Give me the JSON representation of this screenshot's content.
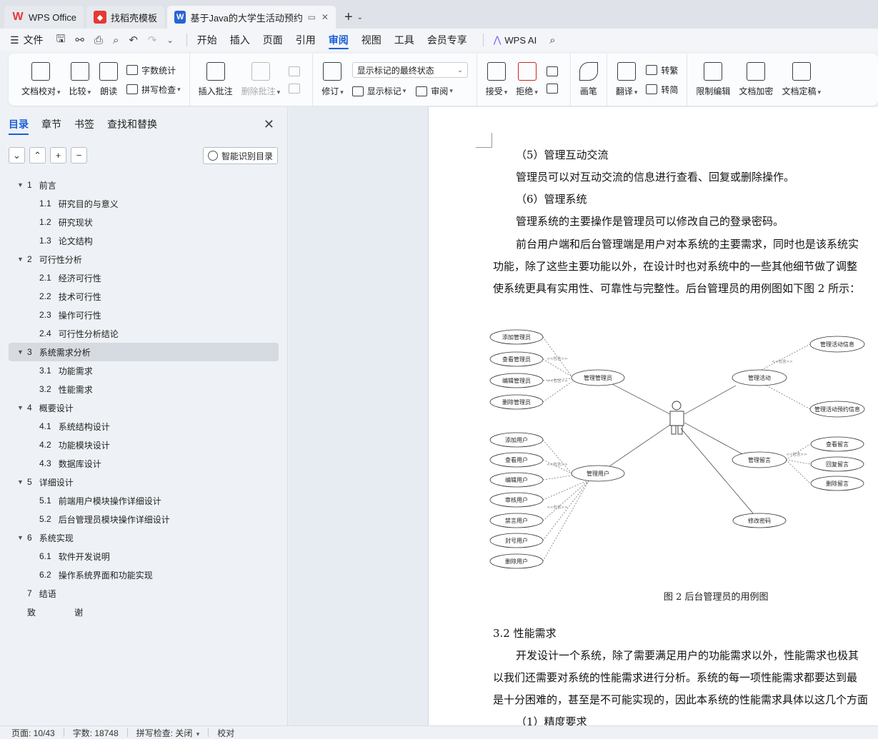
{
  "tabs": [
    {
      "label": "WPS Office",
      "icon": "wps-logo-icon"
    },
    {
      "label": "找稻壳模板",
      "icon": "daoke-logo-icon"
    },
    {
      "label": "基于Java的大学生活动预约系",
      "icon": "writer-logo-icon"
    }
  ],
  "menubar": {
    "file": "文件",
    "items": [
      "开始",
      "插入",
      "页面",
      "引用",
      "审阅",
      "视图",
      "工具",
      "会员专享"
    ],
    "active": "审阅",
    "ai": "WPS AI"
  },
  "ribbon": {
    "doc_check": "文档校对",
    "compare": "比较",
    "read": "朗读",
    "word_count": "字数统计",
    "spell_check": "拼写检查",
    "insert_comment": "插入批注",
    "delete_comment": "删除批注",
    "revise": "修订",
    "show_mode": "显示标记的最终状态",
    "show_marks": "显示标记",
    "review": "审阅",
    "accept": "接受",
    "reject": "拒绝",
    "ink": "画笔",
    "translate": "翻译",
    "to_traditional": "转繁",
    "to_simplified": "转简",
    "restrict_edit": "限制编辑",
    "encrypt": "文档加密",
    "finalize": "文档定稿"
  },
  "nav": {
    "tabs": [
      "目录",
      "章节",
      "书签",
      "查找和替换"
    ],
    "smart_toc": "智能识别目录",
    "toc": [
      {
        "num": "1",
        "title": "前言",
        "level": 1,
        "expanded": true
      },
      {
        "num": "1.1",
        "title": "研究目的与意义",
        "level": 2
      },
      {
        "num": "1.2",
        "title": "研究现状",
        "level": 2
      },
      {
        "num": "1.3",
        "title": "论文结构",
        "level": 2
      },
      {
        "num": "2",
        "title": "可行性分析",
        "level": 1,
        "expanded": true
      },
      {
        "num": "2.1",
        "title": "经济可行性",
        "level": 2
      },
      {
        "num": "2.2",
        "title": "技术可行性",
        "level": 2
      },
      {
        "num": "2.3",
        "title": "操作可行性",
        "level": 2
      },
      {
        "num": "2.4",
        "title": "可行性分析结论",
        "level": 2
      },
      {
        "num": "3",
        "title": "系统需求分析",
        "level": 1,
        "expanded": true,
        "selected": true
      },
      {
        "num": "3.1",
        "title": "功能需求",
        "level": 2
      },
      {
        "num": "3.2",
        "title": "性能需求",
        "level": 2
      },
      {
        "num": "4",
        "title": "概要设计",
        "level": 1,
        "expanded": true
      },
      {
        "num": "4.1",
        "title": "系统结构设计",
        "level": 2
      },
      {
        "num": "4.2",
        "title": "功能模块设计",
        "level": 2
      },
      {
        "num": "4.3",
        "title": "数据库设计",
        "level": 2
      },
      {
        "num": "5",
        "title": "详细设计",
        "level": 1,
        "expanded": true
      },
      {
        "num": "5.1",
        "title": "前端用户模块操作详细设计",
        "level": 2
      },
      {
        "num": "5.2",
        "title": "后台管理员模块操作详细设计",
        "level": 2
      },
      {
        "num": "6",
        "title": "系统实现",
        "level": 1,
        "expanded": true
      },
      {
        "num": "6.1",
        "title": "软件开发说明",
        "level": 2
      },
      {
        "num": "6.2",
        "title": "操作系统界面和功能实现",
        "level": 2
      },
      {
        "num": "7",
        "title": "结语",
        "level": 1,
        "expanded": false
      },
      {
        "num": "致",
        "title": "谢",
        "level": 1,
        "expanded": false,
        "wide": true
      }
    ]
  },
  "doc": {
    "lines": [
      "（5）管理互动交流",
      "管理员可以对互动交流的信息进行查看、回复或删除操作。",
      "（6）管理系统",
      "管理系统的主要操作是管理员可以修改自己的登录密码。",
      "前台用户端和后台管理端是用户对本系统的主要需求，同时也是该系统实",
      "功能，除了这些主要功能以外，在设计时也对系统中的一些其他细节做了调整",
      "使系统更具有实用性、可靠性与完整性。后台管理员的用例图如下图 2 所示：",
      "3.2    性能需求",
      "开发设计一个系统，除了需要满足用户的功能需求以外，性能需求也极其",
      "以我们还需要对系统的性能需求进行分析。系统的每一项性能需求都要达到最",
      "是十分困难的，甚至是不可能实现的，因此本系统的性能需求具体以这几个方面",
      "（1）精度要求"
    ],
    "figure_caption": "图 2  后台管理员的用例图",
    "diagram": {
      "left_top": [
        "添加管理员",
        "查看管理员",
        "编辑管理员",
        "删除管理员"
      ],
      "manage_admin": "管理管理员",
      "left_bottom": [
        "添加用户",
        "查看用户",
        "编辑用户",
        "审核用户",
        "禁言用户",
        "封号用户",
        "删除用户"
      ],
      "manage_user": "管理用户",
      "manage_activity": "管理活动",
      "activity_subs": [
        "管理活动信息",
        "管理活动预约信息"
      ],
      "manage_message": "管理留言",
      "message_subs": [
        "查看留言",
        "回复留言",
        "删除留言"
      ],
      "change_password": "修改密码",
      "relation_label": "<<包含>>"
    }
  },
  "status": {
    "page": "页面: 10/43",
    "words": "字数: 18748",
    "spell": "拼写检查: 关闭",
    "proof": "校对"
  }
}
